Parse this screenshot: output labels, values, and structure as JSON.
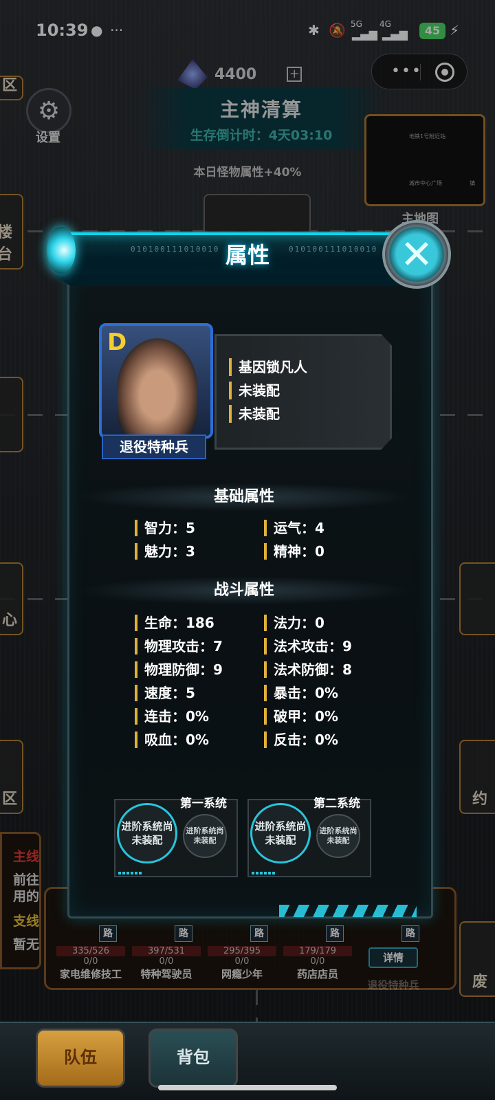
{
  "status_bar": {
    "time": "10:39",
    "battery": "45",
    "signal_5g": "5G",
    "signal_4g": "4G",
    "icons": [
      "notification-dot-icon",
      "more-icon",
      "bluetooth-icon",
      "mute-icon",
      "signal-icon",
      "charging-icon"
    ]
  },
  "hud": {
    "currency_value": "4400",
    "plus_label": "+",
    "settings_label": "设置",
    "title": "主神清算",
    "countdown": "生存倒计时：4天03:10",
    "monster_note": "本日怪物属性+40%",
    "minimap_label": "主地图",
    "minimap_nodes": [
      "地铁1号附近站",
      "城市中心广场",
      "镇"
    ]
  },
  "map_labels": {
    "left_1": "区",
    "left_2": "楼台",
    "left_3": "心",
    "left_4": "区",
    "right_1": "约",
    "right_2": "废"
  },
  "modal": {
    "title": "属性",
    "close_label": "✕",
    "binary_text": "010100111010010",
    "character": {
      "grade": "D",
      "name": "退役特种兵",
      "equip": [
        "基因锁凡人",
        "未装配",
        "未装配"
      ]
    },
    "basic_title": "基础属性",
    "basic_stats": [
      {
        "label": "智力：5"
      },
      {
        "label": "运气：4"
      },
      {
        "label": "魅力：3"
      },
      {
        "label": "精神：0"
      }
    ],
    "combat_title": "战斗属性",
    "combat_stats": [
      {
        "label": "生命：186"
      },
      {
        "label": "法力：0"
      },
      {
        "label": "物理攻击：7"
      },
      {
        "label": "法术攻击：9"
      },
      {
        "label": "物理防御：9"
      },
      {
        "label": "法术防御：8"
      },
      {
        "label": "速度：5"
      },
      {
        "label": "暴击：0%"
      },
      {
        "label": "连击：0%"
      },
      {
        "label": "破甲：0%"
      },
      {
        "label": "吸血：0%"
      },
      {
        "label": "反击：0%"
      }
    ],
    "systems": [
      {
        "title": "第一系统",
        "main": "进阶系统尚未装配",
        "sub": "进阶系统尚未装配"
      },
      {
        "title": "第二系统",
        "main": "进阶系统尚未装配",
        "sub": "进阶系统尚未装配"
      }
    ]
  },
  "quest": {
    "main_label": "主线",
    "main_text_1": "前往",
    "main_text_2": "用的",
    "side_label": "支线",
    "side_text": "暂无"
  },
  "party": [
    {
      "name": "家电维修技工",
      "hp": "335/526",
      "mp": "0/0",
      "road": "路"
    },
    {
      "name": "特种驾驶员",
      "hp": "397/531",
      "mp": "0/0",
      "road": "路"
    },
    {
      "name": "网瘾少年",
      "hp": "295/395",
      "mp": "0/0",
      "road": "路"
    },
    {
      "name": "药店店员",
      "hp": "179/179",
      "mp": "0/0",
      "road": "路"
    },
    {
      "name": "退役特种兵",
      "road": "路"
    }
  ],
  "detail_label": "详情",
  "bottom_tabs": {
    "team": "队伍",
    "bag": "背包"
  },
  "colors": {
    "accent_cyan": "#0fd6ea",
    "stat_marker": "#e0b13a",
    "grade_yellow": "#f5cf2e",
    "quest_red": "#e33b3b",
    "quest_yellow": "#e8c43a"
  }
}
